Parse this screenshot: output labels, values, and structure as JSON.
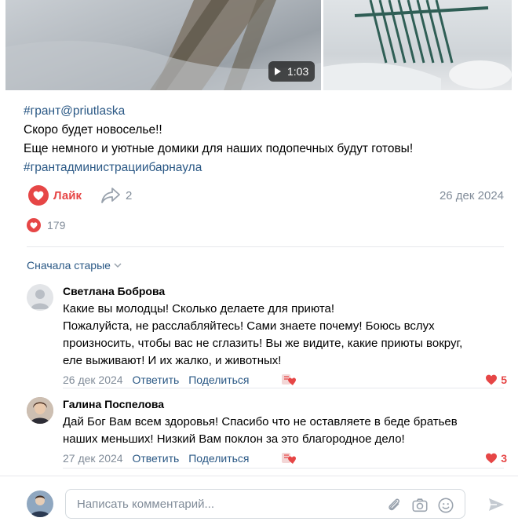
{
  "video": {
    "duration": "1:03"
  },
  "post": {
    "lines": [
      "#грант@priutlaska",
      "Скоро будет новоселье!!",
      "Еще немного и уютные домики для наших подопечных будут готовы!",
      "#грантадминистрациибарнаула"
    ],
    "like_label": "Лайк",
    "share_count": "2",
    "date": "26 дек 2024",
    "likes_count": "179"
  },
  "comments_sort": "Сначала старые",
  "comments": [
    {
      "author": "Светлана Боброва",
      "lines": [
        "Какие вы молодцы! Сколько делаете для приюта!",
        "Пожалуйста, не расслабляйтесь! Сами знаете почему! Боюсь вслух",
        "произносить, чтобы вас не сглазить! Вы же видите, какие приюты вокруг,",
        "еле выживают! И их жалко, и животных!"
      ],
      "date": "26 дек 2024",
      "reply": "Ответить",
      "share": "Поделиться",
      "likes": "5"
    },
    {
      "author": "Галина Поспелова",
      "lines": [
        "Дай Бог Вам всем здоровья! Спасибо что не оставляете в беде братьев",
        "наших меньших! Низкий Вам поклон за это благородное дело!"
      ],
      "date": "27 дек 2024",
      "reply": "Ответить",
      "share": "Поделиться",
      "likes": "3"
    }
  ],
  "composer": {
    "placeholder": "Написать комментарий..."
  },
  "colors": {
    "accent": "#2a5885",
    "like_red": "#e64646",
    "muted": "#818c99"
  }
}
